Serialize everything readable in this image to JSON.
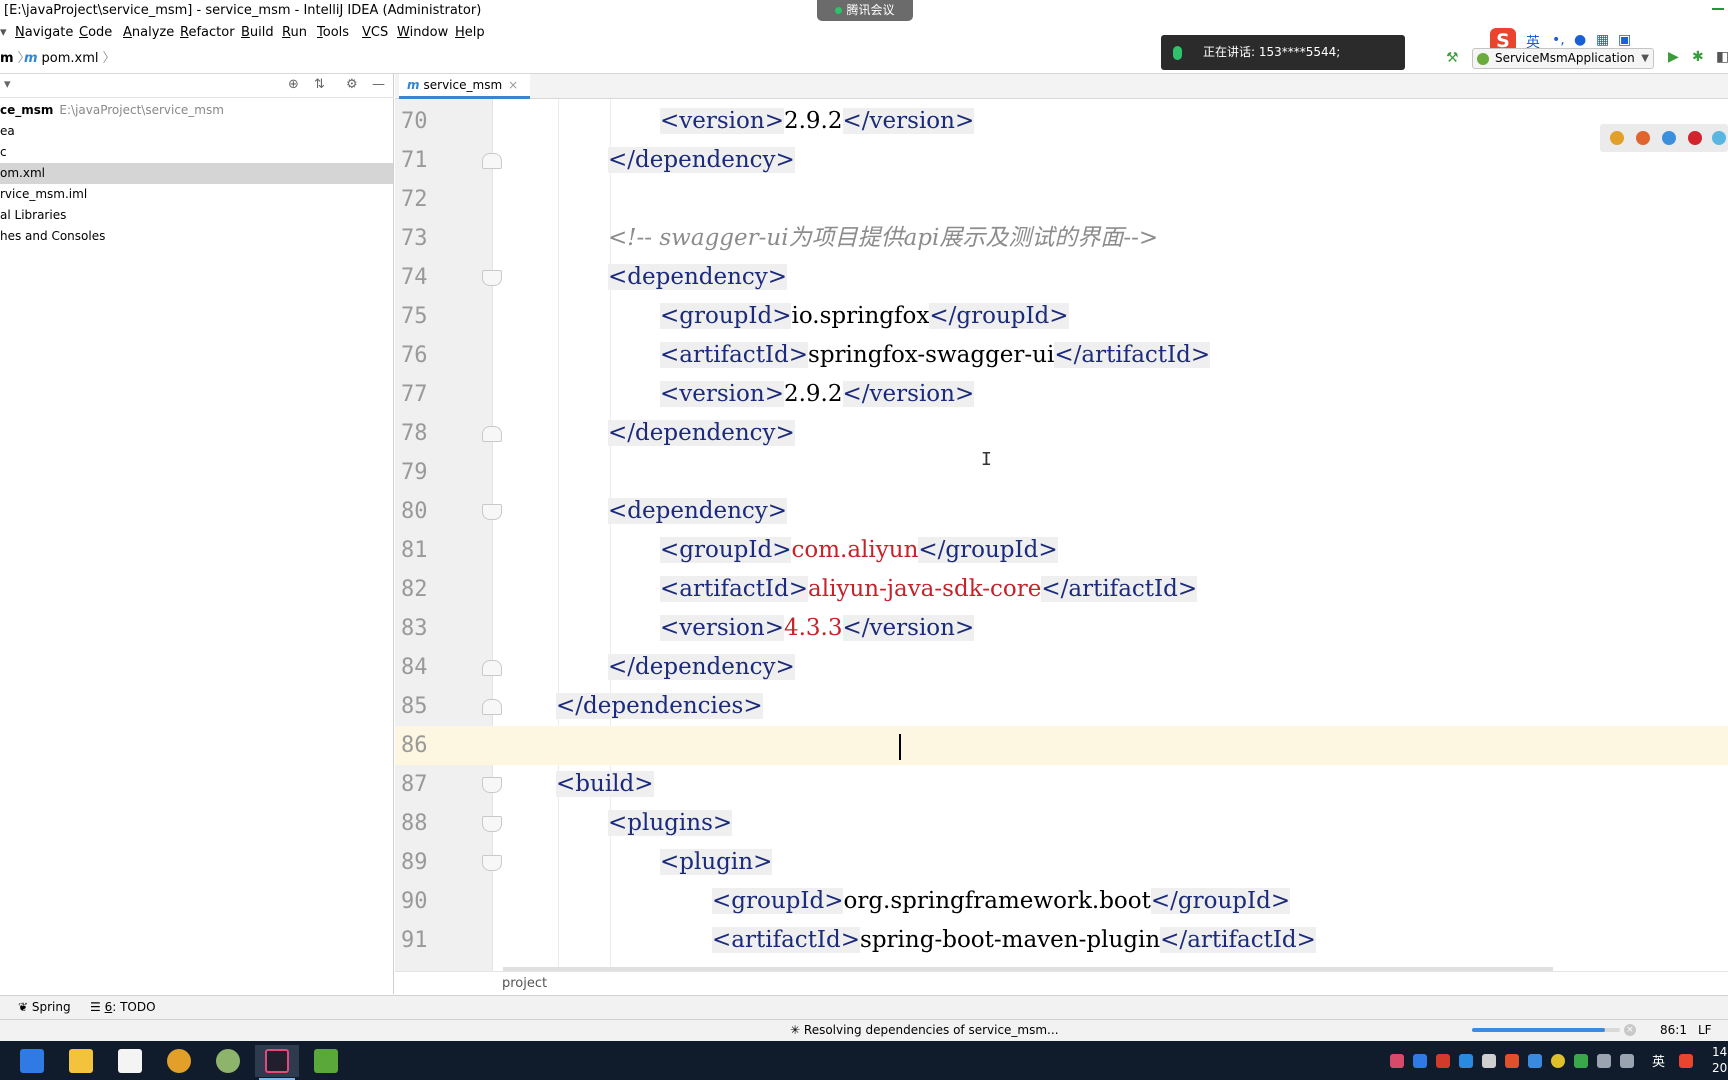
{
  "titlebar": {
    "title": "[E:\\javaProject\\service_msm] - service_msm - IntelliJ IDEA (Administrator)",
    "meeting_app": "腾讯会议"
  },
  "menu": [
    "Navigate",
    "Code",
    "Analyze",
    "Refactor",
    "Build",
    "Run",
    "Tools",
    "VCS",
    "Window",
    "Help"
  ],
  "navbar": {
    "root": "m",
    "file": "pom.xml"
  },
  "meeting_banner": "正在讲话: 153****5544;",
  "ime": {
    "lang": "英"
  },
  "run_config": "ServiceMsmApplication",
  "project_tree": {
    "root_name": "ce_msm",
    "root_path": "E:\\javaProject\\service_msm",
    "items": [
      "ea",
      "c",
      "om.xml",
      "rvice_msm.iml",
      "al Libraries",
      "hes and Consoles"
    ]
  },
  "editor": {
    "tab_label": "service_msm",
    "breadcrumb": "project"
  },
  "code_lines": [
    {
      "no": "70",
      "pre": "<",
      "tag": "version",
      "text": "2.9.2",
      "post": "version"
    },
    {
      "no": "71",
      "close": "dependency"
    },
    {
      "no": "72"
    },
    {
      "no": "73",
      "comment": "<!-- swagger-ui为项目提供api展示及测试的界面-->"
    },
    {
      "no": "74",
      "open": "dependency"
    },
    {
      "no": "75",
      "tag": "groupId",
      "text": "io.springfox"
    },
    {
      "no": "76",
      "tag": "artifactId",
      "text": "springfox-swagger-ui"
    },
    {
      "no": "77",
      "tag": "version",
      "text": "2.9.2"
    },
    {
      "no": "78",
      "close": "dependency"
    },
    {
      "no": "79"
    },
    {
      "no": "80",
      "open": "dependency"
    },
    {
      "no": "81",
      "tag": "groupId",
      "text": "com.aliyun"
    },
    {
      "no": "82",
      "tag": "artifactId",
      "text": "aliyun-java-sdk-core"
    },
    {
      "no": "83",
      "tag": "version",
      "text": "4.3.3"
    },
    {
      "no": "84",
      "close": "dependency"
    },
    {
      "no": "85",
      "close": "dependencies"
    },
    {
      "no": "86"
    },
    {
      "no": "87",
      "open": "build"
    },
    {
      "no": "88",
      "open": "plugins"
    },
    {
      "no": "89",
      "open": "plugin"
    },
    {
      "no": "90",
      "tag": "groupId",
      "text": "org.springframework.boot"
    },
    {
      "no": "91",
      "tag": "artifactId",
      "text": "spring-boot-maven-plugin"
    }
  ],
  "tool_windows": {
    "spring": "Spring",
    "todo_num": "6",
    "todo": ": TODO"
  },
  "status": {
    "message": "Resolving dependencies of service_msm...",
    "progress": 0.9,
    "position": "86:1",
    "line_sep": "LF"
  },
  "taskbar": {
    "clock_time": "14",
    "clock_date": "20"
  },
  "colors": {
    "tag": "#1b2a7a",
    "value_red": "#c5222a",
    "comment": "#8c8c8c",
    "accent": "#4083c9"
  }
}
